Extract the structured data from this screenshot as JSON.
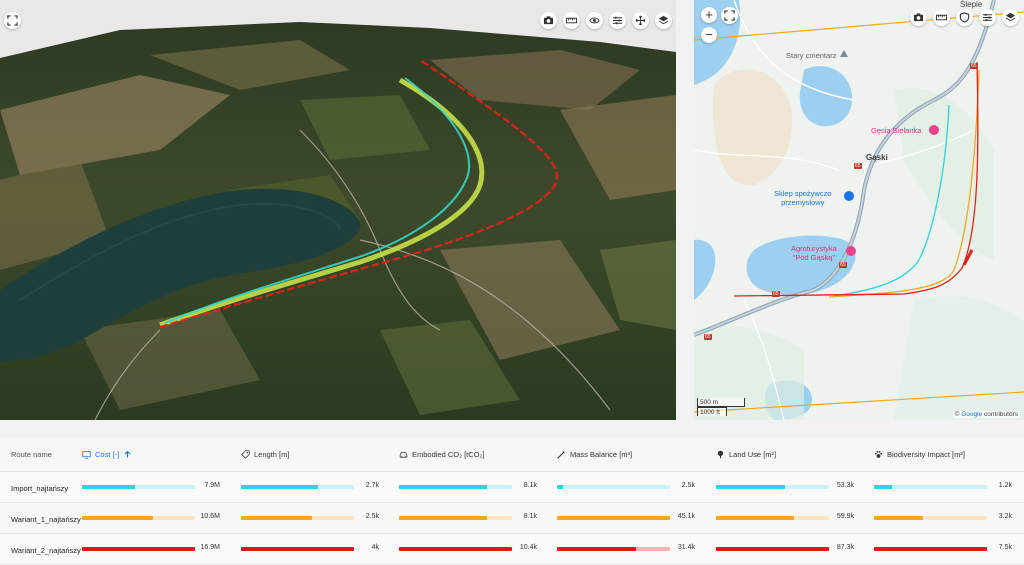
{
  "view3d": {
    "toolbar": [
      "camera-icon",
      "ruler-icon",
      "eye-icon",
      "sliders-icon",
      "move-icon",
      "layers-icon"
    ]
  },
  "map": {
    "labels": {
      "slepie": "Ślepie",
      "cemetery": "Stary cmentarz",
      "gesia": "Gęsia Sielanka",
      "gaski": "Gąski",
      "shop": "Sklep spożywczo\nprzemysłowy",
      "agro": "Agroturystyka\n\"Pod Gąską\""
    },
    "road_number": "65",
    "scale_metric": "500 m",
    "scale_imperial": "1000 ft",
    "attribution_prefix": "©",
    "attribution_google": "Google",
    "attribution_suffix": "contributors",
    "zoom_in": "+",
    "zoom_out": "−"
  },
  "table": {
    "columns": {
      "route": "Route name",
      "cost": "Cost [-]",
      "length": "Length [m]",
      "embodied": "Embodied CO₂ [tCO₂]",
      "mass": "Mass Balance [m³]",
      "land": "Land Use [m²]",
      "bio": "Biodiversity Impact [m²]"
    },
    "rows": [
      {
        "name": "Import_najtańszy",
        "color": "#2bd4e0",
        "light": "#c9f3f7",
        "values": [
          "7.9M",
          "2.7k",
          "8.1k",
          "2.5k",
          "53.3k",
          "1.2k"
        ],
        "fractions": [
          0.47,
          0.68,
          0.78,
          0.055,
          0.61,
          0.16
        ]
      },
      {
        "name": "Wariant_1_najtańszy",
        "color": "#f5a623",
        "light": "#fde6bf",
        "values": [
          "10.6M",
          "2.5k",
          "8.1k",
          "45.1k",
          "59.9k",
          "3.2k"
        ],
        "fractions": [
          0.63,
          0.63,
          0.78,
          1.0,
          0.69,
          0.43
        ]
      },
      {
        "name": "Wariant_2_najtańszy",
        "color": "#e8131a",
        "light": "#f6b5b5",
        "values": [
          "16.9M",
          "4k",
          "10.4k",
          "31.4k",
          "87.3k",
          "7.5k"
        ],
        "fractions": [
          1.0,
          1.0,
          1.0,
          0.7,
          1.0,
          1.0
        ]
      }
    ]
  }
}
